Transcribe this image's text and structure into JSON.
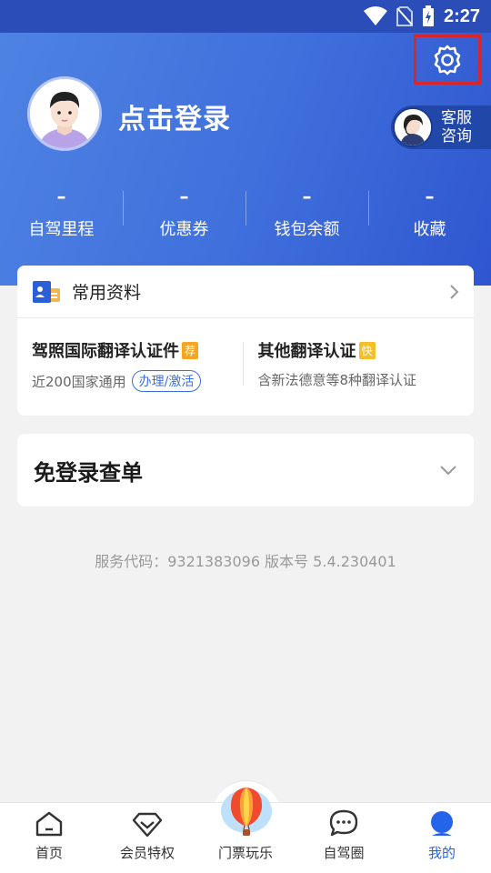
{
  "status_bar": {
    "time": "2:27"
  },
  "profile": {
    "login_text": "点击登录"
  },
  "customer_service": {
    "label_line1": "客服",
    "label_line2": "咨询"
  },
  "stats": [
    {
      "value": "–",
      "label": "自驾里程"
    },
    {
      "value": "–",
      "label": "优惠券"
    },
    {
      "value": "–",
      "label": "钱包余额"
    },
    {
      "value": "–",
      "label": "收藏"
    }
  ],
  "common_info": {
    "title": "常用资料",
    "items": [
      {
        "title": "驾照国际翻译认证件",
        "tag": "荐",
        "subtitle": "近200国家通用",
        "action": "办理/激活"
      },
      {
        "title": "其他翻译认证",
        "tag": "快",
        "subtitle": "含新法德意等8种翻译认证"
      }
    ]
  },
  "query": {
    "title": "免登录查单"
  },
  "footer_info": {
    "text": "服务代码：9321383096 版本号 5.4.230401"
  },
  "tabbar": [
    {
      "label": "首页",
      "icon": "home-icon"
    },
    {
      "label": "会员特权",
      "icon": "diamond-icon"
    },
    {
      "label": "门票玩乐",
      "icon": "balloon-icon"
    },
    {
      "label": "自驾圈",
      "icon": "chat-bubble-icon"
    },
    {
      "label": "我的",
      "icon": "user-icon",
      "active": true
    }
  ],
  "colors": {
    "primary": "#2563eb",
    "header_start": "#4f83e3",
    "header_end": "#2f56cf",
    "highlight_box": "#d9262c"
  }
}
